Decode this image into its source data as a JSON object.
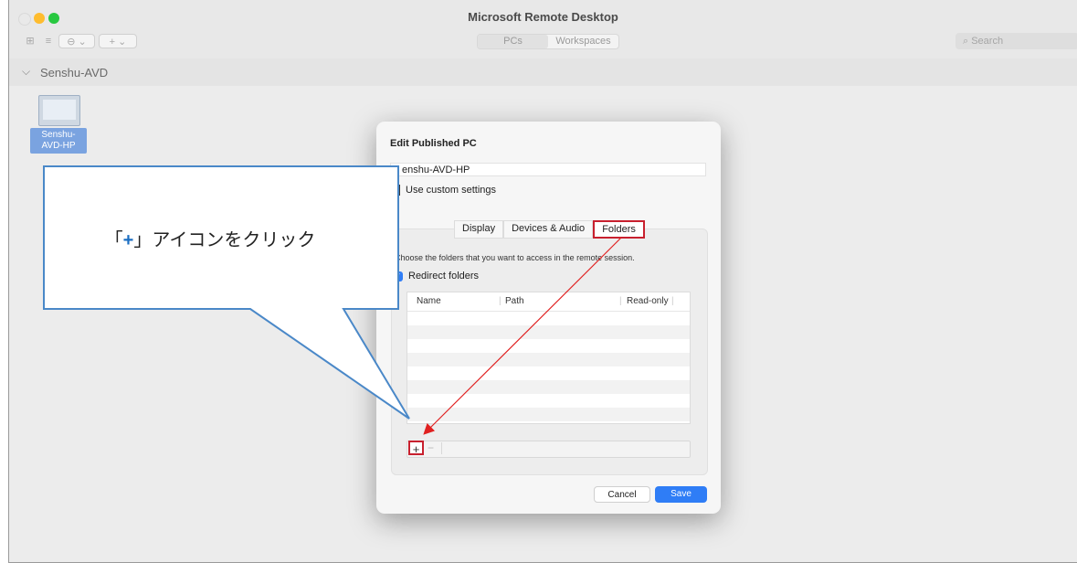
{
  "window": {
    "title": "Microsoft Remote Desktop",
    "colors": {
      "close": "#ff5f57",
      "minimize": "#febc2e",
      "zoom": "#28c840"
    }
  },
  "toolbar": {
    "view_grid_icon": "grid-icon",
    "view_list_icon": "list-icon",
    "settings_dropdown": "⊖ ⌄",
    "add_dropdown": "+ ⌄",
    "tabs": [
      "PCs",
      "Workspaces"
    ],
    "search_placeholder": "Search"
  },
  "group": {
    "name": "Senshu-AVD"
  },
  "pc": {
    "label": "Senshu-\nAVD-HP"
  },
  "dialog": {
    "title": "Edit Published PC",
    "name_value": "enshu-AVD-HP",
    "custom_settings_label": "Use custom settings",
    "tabs": [
      "Display",
      "Devices & Audio",
      "Folders"
    ],
    "active_tab": "Folders",
    "description": "Choose the folders that you want to access in the remote session.",
    "redirect_label": "Redirect folders",
    "redirect_checked": true,
    "columns": [
      "Name",
      "Path",
      "Read-only"
    ],
    "add_label": "+",
    "remove_label": "−",
    "cancel_label": "Cancel",
    "save_label": "Save",
    "accent_color": "#2f7df6"
  },
  "annotation": {
    "text_before": "「",
    "plus": "+",
    "text_after": "」アイコンをクリック",
    "highlight_color": "#c8202e",
    "bubble_border": "#4a88c8"
  }
}
